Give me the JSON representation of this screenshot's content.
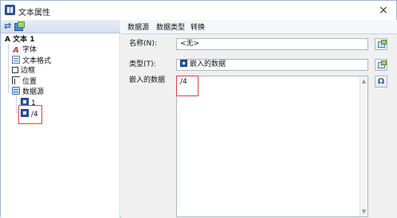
{
  "window": {
    "title": "文本属性",
    "close_glyph": "×"
  },
  "tree": {
    "toolbar": {
      "expand_icon": "expand-all-icon",
      "collapse_icon": "collapse-icon"
    },
    "root_label": "文本 1",
    "items": [
      {
        "label": "字体",
        "icon": "font-icon"
      },
      {
        "label": "文本格式",
        "icon": "text-format-icon"
      },
      {
        "label": "边框",
        "icon": "border-icon"
      },
      {
        "label": "位置",
        "icon": "position-icon"
      },
      {
        "label": "数据源",
        "icon": "datasource-icon"
      }
    ],
    "datasource_children": [
      {
        "label": "1",
        "icon": "embedded-data-icon"
      },
      {
        "label": "/4",
        "icon": "embedded-data-icon",
        "selected": true
      }
    ]
  },
  "tabs": [
    {
      "label": "数据源",
      "active": true
    },
    {
      "label": "数据类型",
      "active": false
    },
    {
      "label": "转换",
      "active": false
    }
  ],
  "form": {
    "name_label": "名称(N):",
    "name_value": "<无>",
    "type_label": "类型(T):",
    "type_value": "嵌入的数据",
    "embedded_label": "嵌入的数据",
    "embedded_value": "/4",
    "omega_button": "Ω"
  },
  "colors": {
    "highlight": "#e04040",
    "accent": "#2e55a5"
  }
}
